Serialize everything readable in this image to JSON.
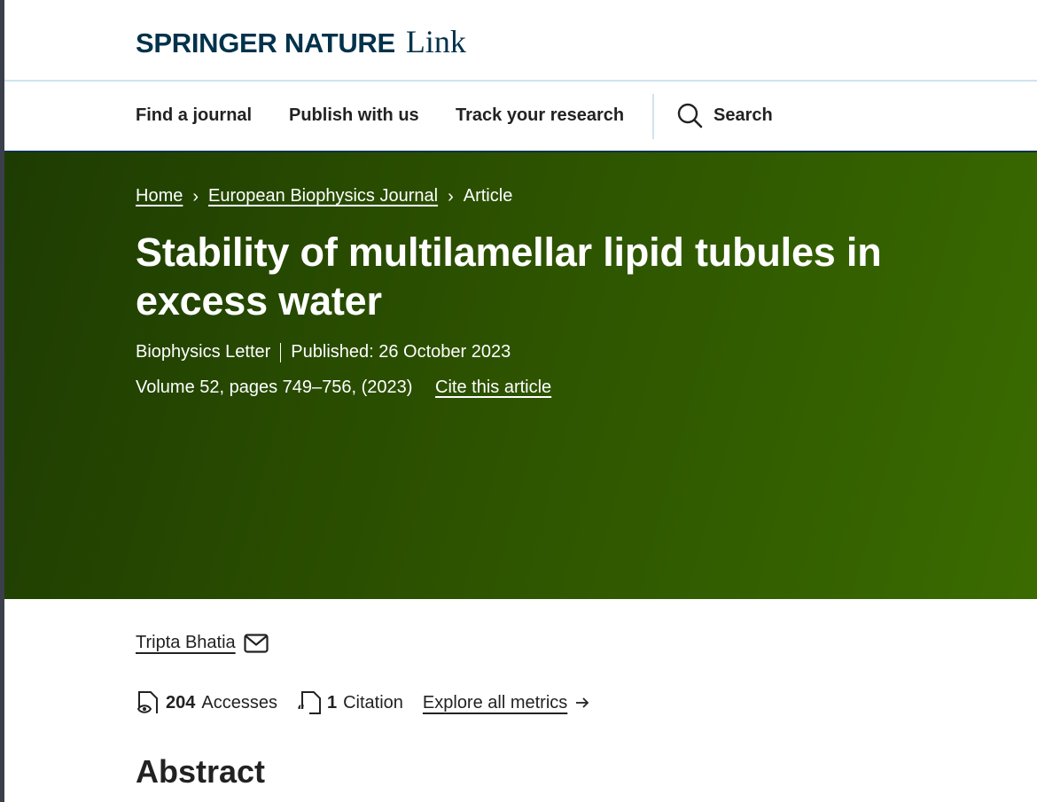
{
  "brand": {
    "name": "SPRINGER NATURE",
    "product": "Link"
  },
  "nav": {
    "find_journal": "Find a journal",
    "publish": "Publish with us",
    "track": "Track your research",
    "search": "Search"
  },
  "breadcrumb": {
    "home": "Home",
    "journal": "European Biophysics Journal",
    "current": "Article"
  },
  "article": {
    "title": "Stability of multilamellar lipid tubules in excess water",
    "type": "Biophysics Letter",
    "published": "Published: 26 October 2023",
    "volume": "Volume 52, pages 749–756, (2023)",
    "cite_link": "Cite this article",
    "author": "Tripta Bhatia"
  },
  "metrics": {
    "accesses_count": "204",
    "accesses_label": "Accesses",
    "citations_count": "1",
    "citations_label": "Citation",
    "explore_link": "Explore all metrics"
  },
  "sections": {
    "abstract_heading": "Abstract"
  },
  "colors": {
    "brand_navy": "#01324b",
    "hero_dark": "#1e3c02",
    "hero_light": "#3a6b00",
    "divider": "#cfe3ef"
  }
}
